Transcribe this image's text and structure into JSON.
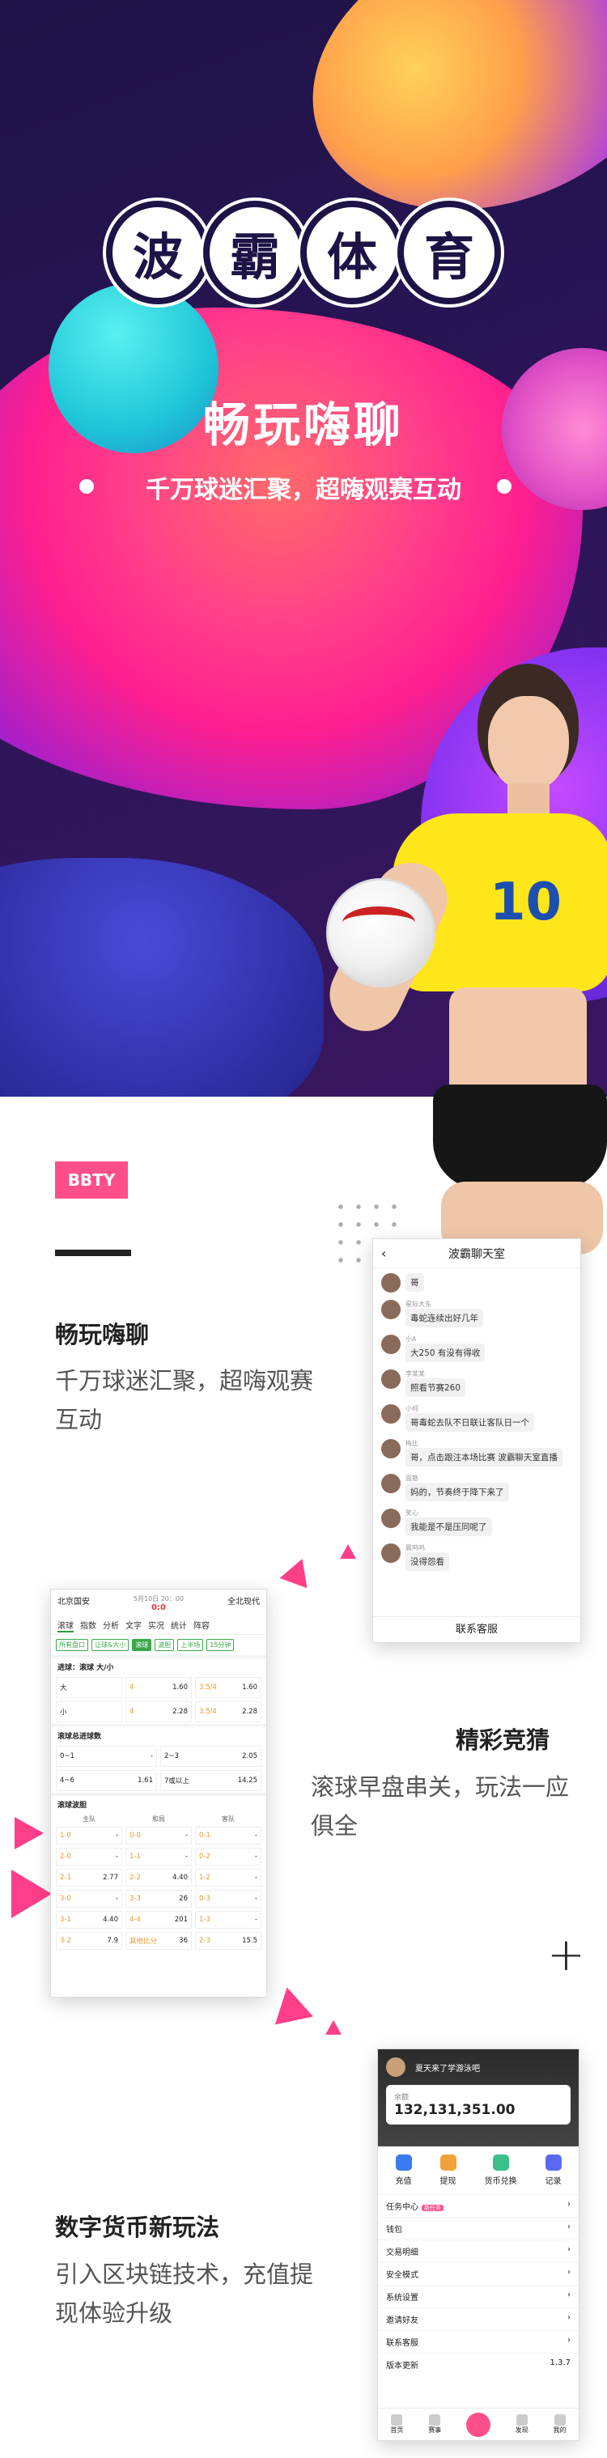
{
  "hero": {
    "title_chars": [
      "波",
      "霸",
      "体",
      "育"
    ],
    "slogan": "畅玩嗨聊",
    "subslogan": "千万球迷汇聚，超嗨观赛互动",
    "jersey_number": "10"
  },
  "badge": "BBTY",
  "features": [
    {
      "title": "畅玩嗨聊",
      "desc_lines": [
        "千万球迷汇聚，超嗨观赛",
        "互动"
      ]
    },
    {
      "title": "精彩竞猜",
      "desc_lines": [
        "滚球早盘串关，玩法一应",
        "俱全"
      ]
    },
    {
      "title": "数字货币新玩法",
      "desc_lines": [
        "引入区块链技术，充值提",
        "现体验升级"
      ]
    }
  ],
  "chat_phone": {
    "title": "波霸聊天室",
    "messages": [
      {
        "name": "",
        "text": "哥"
      },
      {
        "name": "星际大东",
        "text": "毒蛇连续出好几年"
      },
      {
        "name": "小A",
        "text": "大250 有没有得收"
      },
      {
        "name": "李某某",
        "text": "照看节赛260"
      },
      {
        "name": "小柯",
        "text": "哥毒蛇去队不日联让客队日一个"
      },
      {
        "name": "梅比",
        "text": "哥，点击跟注本场比赛 波霸聊天室直播"
      },
      {
        "name": "面筋",
        "text": "妈的，节奏终于降下来了"
      },
      {
        "name": "笑心",
        "text": "我能是不是压同呢了"
      },
      {
        "name": "晨鸣鸣",
        "text": "没得怨看"
      }
    ],
    "footer": "联系客服"
  },
  "odds_phone": {
    "home": "北京国安",
    "away": "全北现代",
    "time": "5月10日 20：00",
    "score": "0:0",
    "tabs": [
      "滚球",
      "指数",
      "分析",
      "文字",
      "实况",
      "统计",
      "阵容"
    ],
    "chips": [
      "所有盘口",
      "让球&大小",
      "滚球",
      "波胆",
      "上半场",
      "15分钟"
    ],
    "sections": [
      {
        "title": "进球：滚球 大/小",
        "rows": [
          [
            "大",
            "4",
            "1.60",
            "3.5/4",
            "1.60"
          ],
          [
            "小",
            "4",
            "2.28",
            "3.5/4",
            "2.28"
          ]
        ]
      },
      {
        "title": "滚球总进球数",
        "rows": [
          [
            "0~1",
            "-",
            "2~3",
            "2.05"
          ],
          [
            "4~6",
            "1.61",
            "7或以上",
            "14.25"
          ]
        ]
      }
    ],
    "correct_score": {
      "title": "滚球波胆",
      "headers": [
        "主队",
        "和局",
        "客队"
      ],
      "cells": [
        [
          "1-0",
          "-",
          "0-0",
          "-",
          "0-1",
          "-"
        ],
        [
          "2-0",
          "-",
          "1-1",
          "-",
          "0-2",
          "-"
        ],
        [
          "2-1",
          "2.77",
          "2-2",
          "4.40",
          "1-2",
          "-"
        ],
        [
          "3-0",
          "-",
          "3-3",
          "26",
          "0-3",
          "-"
        ],
        [
          "3-1",
          "4.40",
          "4-4",
          "201",
          "1-3",
          "-"
        ],
        [
          "3-2",
          "7.9",
          "其他比分",
          "36",
          "2-3",
          "15.5"
        ]
      ]
    }
  },
  "account_phone": {
    "username": "夏天来了学游泳吧",
    "balance_label": "余额",
    "balance": "132,131,351.00",
    "actions": [
      "充值",
      "提现",
      "货币兑换",
      "记录"
    ],
    "menu": [
      "任务中心",
      "钱包",
      "交易明细",
      "安全模式",
      "系统设置",
      "邀请好友",
      "联系客服",
      "版本更新"
    ],
    "version": "1.3.7",
    "task_badge": "新任务",
    "tabbar": [
      "首页",
      "赛事",
      "",
      "发现",
      "我的"
    ]
  },
  "colors": {
    "accent": "#ff4f8a",
    "navy": "#1e1347",
    "yellow": "#ffe93b",
    "green": "#3aa84a"
  }
}
